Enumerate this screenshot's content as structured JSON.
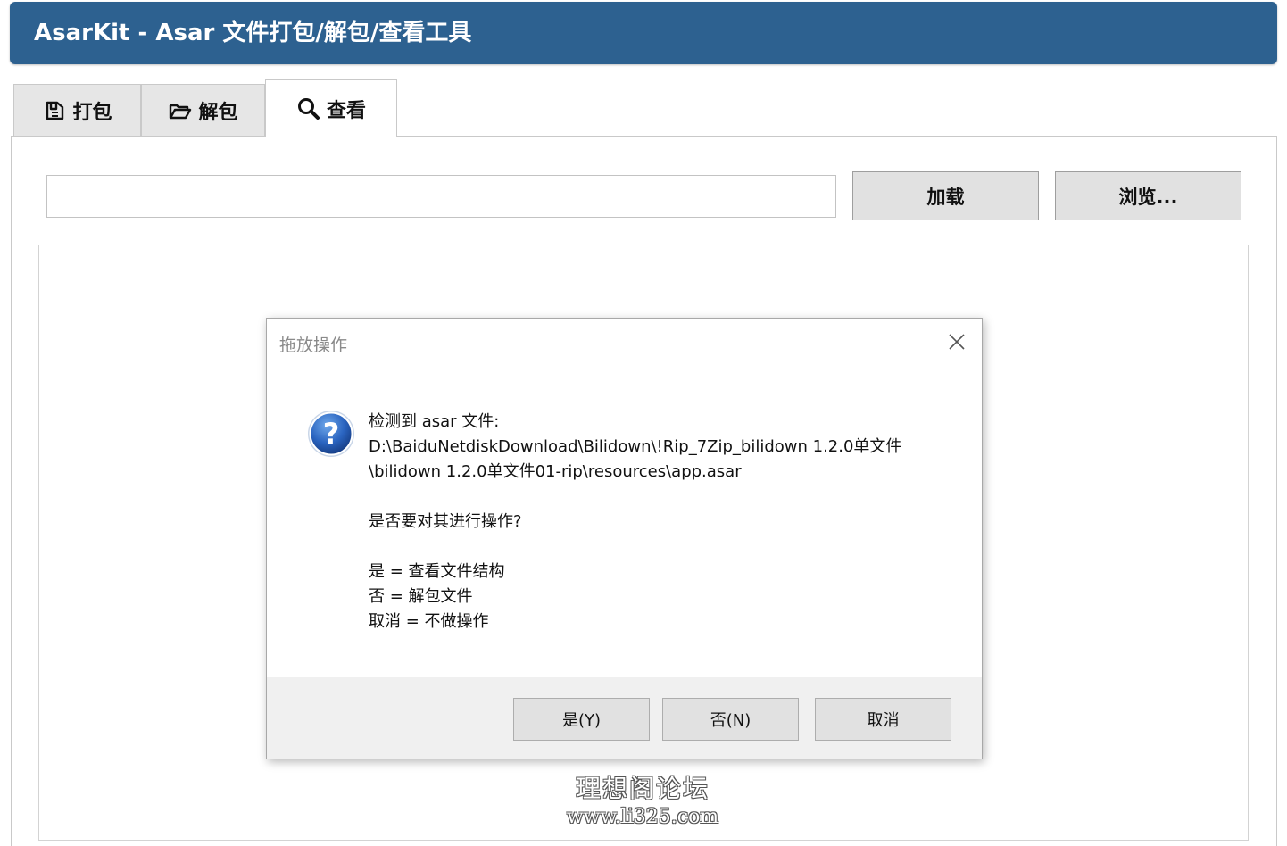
{
  "app": {
    "title": "AsarKit - Asar 文件打包/解包/查看工具",
    "colors": {
      "header": "#2d6190",
      "tab_inactive": "#e6e6e6",
      "button": "#e1e1e1"
    }
  },
  "tabs": [
    {
      "label": "打包",
      "icon": "pack-icon",
      "active": false
    },
    {
      "label": "解包",
      "icon": "folder-open-icon",
      "active": false
    },
    {
      "label": "查看",
      "icon": "search-icon",
      "active": true
    }
  ],
  "view": {
    "path_value": "",
    "load_label": "加载",
    "browse_label": "浏览..."
  },
  "dialog": {
    "title": "拖放操作",
    "icon": "question-icon",
    "lines": [
      "检测到 asar 文件:",
      "D:\\BaiduNetdiskDownload\\Bilidown\\!Rip_7Zip_bilidown 1.2.0单文件",
      "\\bilidown 1.2.0单文件01-rip\\resources\\app.asar",
      "是否要对其进行操作?",
      "是 = 查看文件结构",
      "否 = 解包文件",
      "取消 = 不做操作"
    ],
    "buttons": {
      "yes": "是(Y)",
      "no": "否(N)",
      "cancel": "取消"
    }
  },
  "watermark": {
    "site_name": "理想阁论坛",
    "url": "www.li325.com"
  }
}
